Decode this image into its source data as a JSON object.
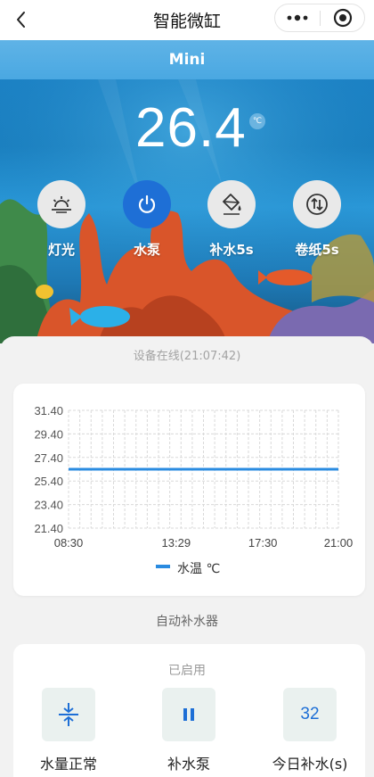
{
  "header": {
    "title": "智能微缸"
  },
  "device": {
    "name": "Mini"
  },
  "temperature": {
    "value": "26.4",
    "unit": "℃"
  },
  "controls": [
    {
      "label": "灯光",
      "icon": "sunrise-icon",
      "active": false
    },
    {
      "label": "水泵",
      "icon": "power-icon",
      "active": true
    },
    {
      "label": "补水5s",
      "icon": "fill-bucket-icon",
      "active": false
    },
    {
      "label": "卷纸5s",
      "icon": "swap-arrows-icon",
      "active": false
    }
  ],
  "status_text": "设备在线(21:07:42)",
  "chart_data": {
    "type": "line",
    "x_ticks": [
      "08:30",
      "13:29",
      "17:30",
      "21:00"
    ],
    "y_ticks": [
      "31.40",
      "29.40",
      "27.40",
      "25.40",
      "23.40",
      "21.40"
    ],
    "ylim": [
      21.4,
      31.4
    ],
    "series": [
      {
        "name": "水温 ℃",
        "color": "#2a8be0",
        "points": [
          {
            "x": "08:30",
            "y": 26.4
          },
          {
            "x": "21:00",
            "y": 26.4
          }
        ]
      }
    ],
    "legend": "bottom-center",
    "grid": true
  },
  "section_title": "自动补水器",
  "refill": {
    "status": "已启用",
    "items": [
      {
        "label": "水量正常",
        "icon": "compress-arrows-icon"
      },
      {
        "label": "补水泵",
        "icon": "pause-icon"
      },
      {
        "label": "今日补水(s)",
        "value": "32"
      }
    ]
  },
  "colors": {
    "accent": "#1e6fd6",
    "chart_line": "#2a8be0"
  }
}
